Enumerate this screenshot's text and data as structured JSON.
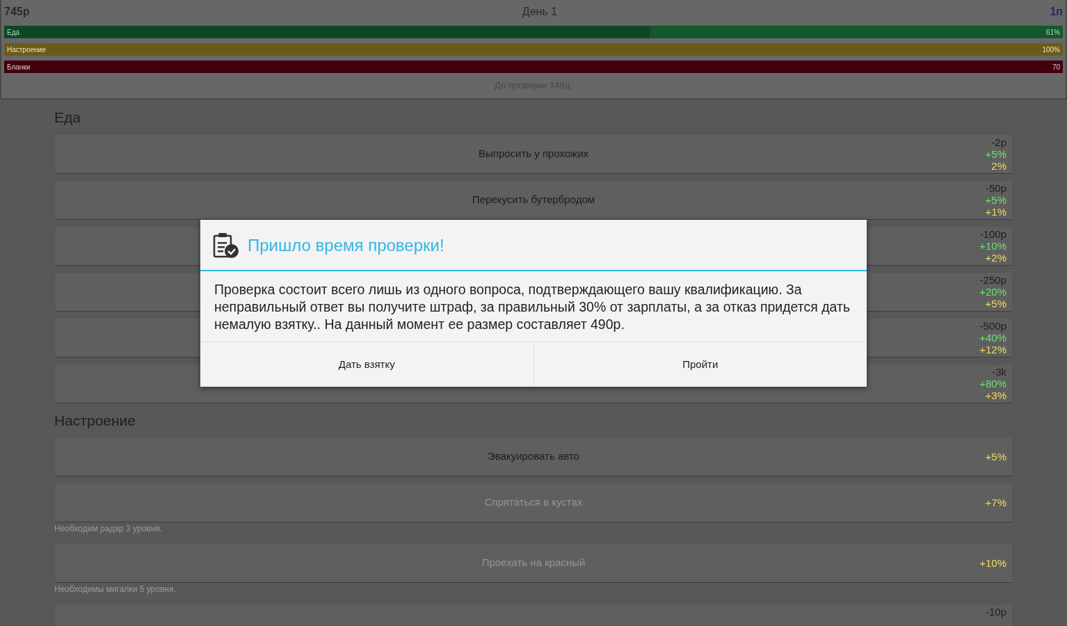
{
  "header": {
    "money": "745р",
    "day": "День 1",
    "rank": "1п",
    "bars": [
      {
        "kind": "food",
        "label": "Еда",
        "reading": "61%",
        "level": 0.61
      },
      {
        "kind": "mood",
        "label": "Настроение",
        "reading": "100%",
        "level": 1
      },
      {
        "kind": "forms",
        "label": "Бланки",
        "reading": "70",
        "level": 1
      }
    ],
    "countdown": "До проверки 149д."
  },
  "sections": [
    {
      "title": "Еда",
      "actions": [
        {
          "title": "Выпросить у прохожих",
          "disabled": false,
          "stats": [
            {
              "kind": "cost",
              "text": "-2р"
            },
            {
              "kind": "food",
              "text": "+5%"
            },
            {
              "kind": "mood",
              "text": "2%"
            }
          ]
        },
        {
          "title": "Перекусить бутербродом",
          "disabled": false,
          "stats": [
            {
              "kind": "cost",
              "text": "-50р"
            },
            {
              "kind": "food",
              "text": "+5%"
            },
            {
              "kind": "mood",
              "text": "+1%"
            }
          ]
        },
        {
          "stats": [
            {
              "kind": "cost",
              "text": "-100р"
            },
            {
              "kind": "food",
              "text": "+10%"
            },
            {
              "kind": "mood",
              "text": "+2%"
            }
          ]
        },
        {
          "stats": [
            {
              "kind": "cost",
              "text": "-250р"
            },
            {
              "kind": "food",
              "text": "+20%"
            },
            {
              "kind": "mood",
              "text": "+5%"
            }
          ]
        },
        {
          "stats": [
            {
              "kind": "cost",
              "text": "-500р"
            },
            {
              "kind": "food",
              "text": "+40%"
            },
            {
              "kind": "mood",
              "text": "+12%"
            }
          ]
        },
        {
          "stats": [
            {
              "kind": "cost",
              "text": "-3k"
            },
            {
              "kind": "food",
              "text": "+80%"
            },
            {
              "kind": "mood",
              "text": "+3%"
            }
          ]
        }
      ]
    },
    {
      "title": "Настроение",
      "actions": [
        {
          "title": "Эвакуировать авто",
          "disabled": false,
          "stats": [
            {
              "kind": "mood",
              "text": "+5%"
            }
          ]
        },
        {
          "title": "Спрятаться в кустах",
          "disabled": true,
          "requirement": "Необходим радар 3 уровня.",
          "stats": [
            {
              "kind": "mood",
              "text": "+7%"
            }
          ]
        },
        {
          "title": "Проехать на красный",
          "disabled": true,
          "requirement": "Необходимы мигалки 5 уровня.",
          "stats": [
            {
              "kind": "mood",
              "text": "+10%"
            }
          ]
        },
        {
          "stats": [
            {
              "kind": "cost",
              "text": "-10р"
            }
          ]
        }
      ]
    }
  ],
  "dialog": {
    "title": "Пришло время проверки!",
    "message": "Проверка состоит всего лишь из одного вопроса, подтверждающего вашу квалификацию. За неправильный ответ вы получите штраф, за правильный 30% от зарплаты, а за отказ придется дать немалую взятку.. На данный момент ее размер составляет 490р.",
    "buttons": [
      "Дать взятку",
      "Пройти"
    ]
  }
}
